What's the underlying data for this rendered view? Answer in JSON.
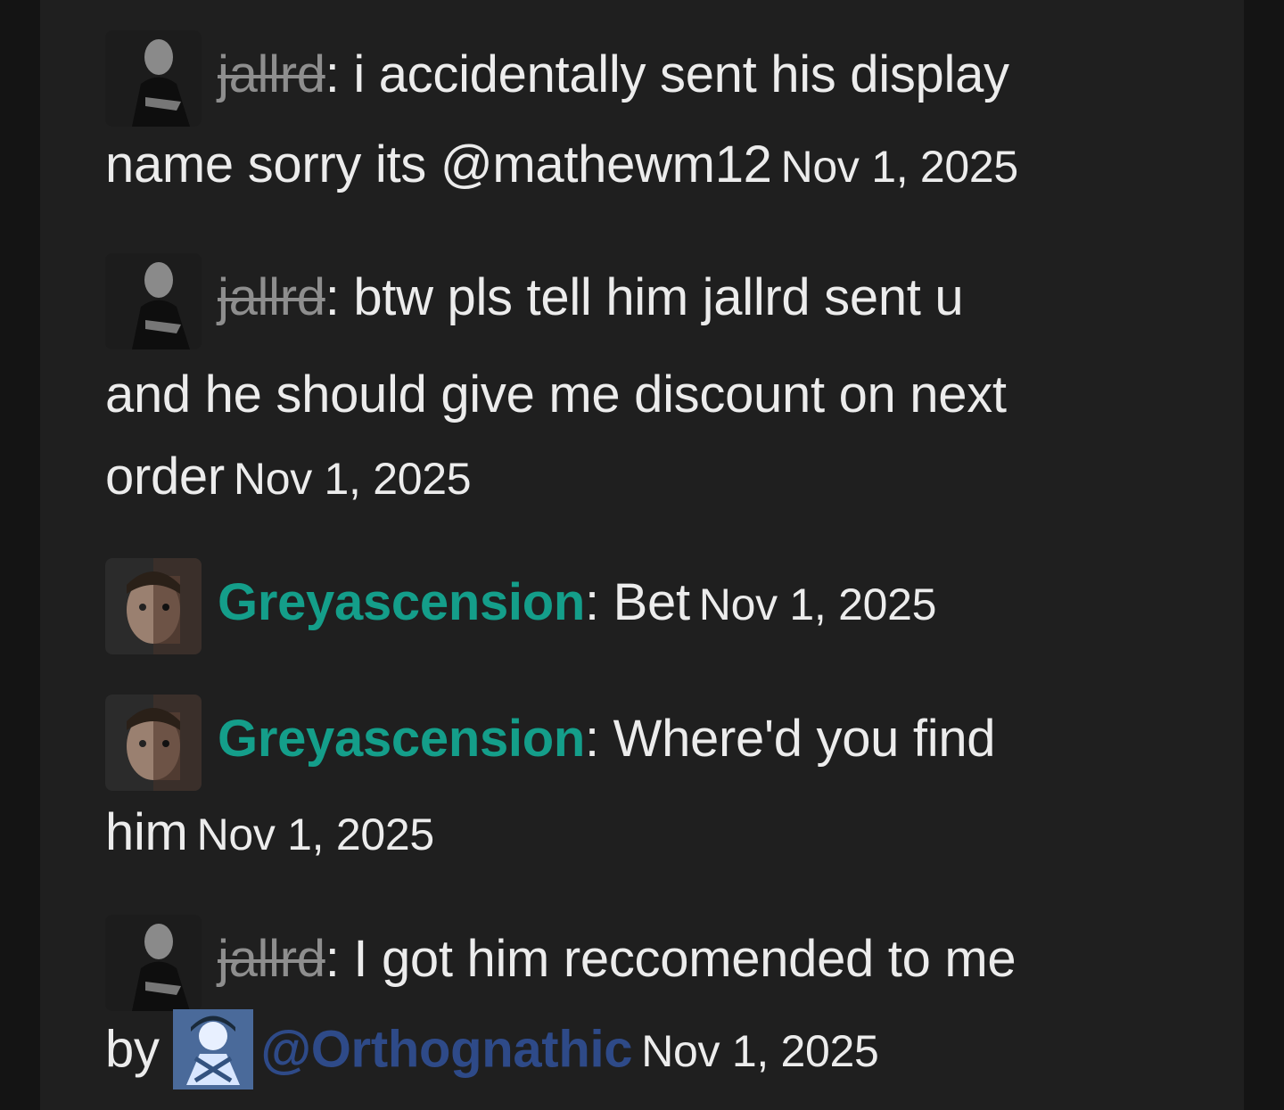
{
  "messages": [
    {
      "user": "jallrd",
      "user_style": "strike",
      "text": "i accidentally sent his display name sorry its @mathewm12",
      "time": "Nov 1, 2025"
    },
    {
      "user": "jallrd",
      "user_style": "strike",
      "text": "btw pls tell him jallrd sent u and he should give me discount on next order",
      "time": "Nov 1, 2025"
    },
    {
      "user": "Greyascension",
      "user_style": "teal",
      "text": "Bet",
      "time": "Nov 1, 2025"
    },
    {
      "user": "Greyascension",
      "user_style": "teal",
      "text": "Where'd you find him",
      "time": "Nov 1, 2025"
    },
    {
      "user": "jallrd",
      "user_style": "strike",
      "text_before": "I got him reccomended to me by",
      "mention": "@Orthognathic",
      "time": "Nov 1, 2025"
    }
  ],
  "colors": {
    "background": "#141414",
    "panel": "#1f1f1f",
    "text": "#ececec",
    "strike_username": "#8e8e8e",
    "teal_username": "#149e8a",
    "mention": "#2e4a88"
  },
  "icons": {
    "jallrd_avatar": "person-photo-avatar",
    "greyascension_avatar": "face-photo-avatar",
    "orthognathic_avatar": "anime-avatar"
  }
}
